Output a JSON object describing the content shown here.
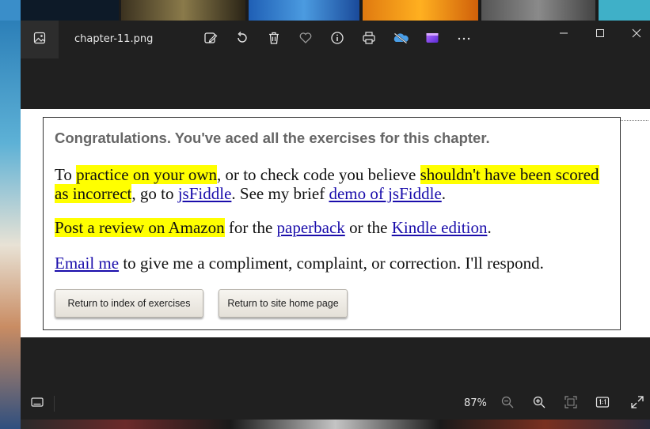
{
  "window": {
    "file_name": "chapter-11.png",
    "toolbar_icons": [
      "edit-image-icon",
      "rotate-icon",
      "delete-icon",
      "favorite-icon",
      "info-icon",
      "print-icon",
      "onedrive-icon",
      "clipchamp-icon",
      "more-icon"
    ],
    "controls": [
      "minimize-icon",
      "maximize-icon",
      "close-icon"
    ]
  },
  "page": {
    "heading": "Congratulations. You've aced all the exercises for this chapter.",
    "p1": {
      "t1": "To ",
      "h1": "practice on your own",
      "t2": ", or to check code you believe ",
      "h2": "shouldn't have been scored as incorrect",
      "t3": ", go to ",
      "l1": "jsFiddle",
      "t4": ". See my brief ",
      "l2": "demo of jsFiddle",
      "t5": "."
    },
    "p2": {
      "h1": "Post a review on Amazon",
      "t1": " for the ",
      "l1": "paperback",
      "t2": " or the ",
      "l2": "Kindle edition",
      "t3": "."
    },
    "p3": {
      "l1": "Email me",
      "t1": " to give me a compliment, complaint, or correction. I'll respond."
    },
    "buttons": {
      "index": "Return to index of exercises",
      "home": "Return to site home page"
    }
  },
  "statusbar": {
    "zoom": "87%",
    "icons": [
      "filmstrip-icon",
      "zoom-out-icon",
      "zoom-in-icon",
      "fit-to-window-icon",
      "actual-size-icon",
      "fullscreen-icon"
    ]
  },
  "colors": {
    "highlight": "#ffff00",
    "link": "#1a0dab",
    "heading": "#666666",
    "window_bg": "#202020"
  }
}
